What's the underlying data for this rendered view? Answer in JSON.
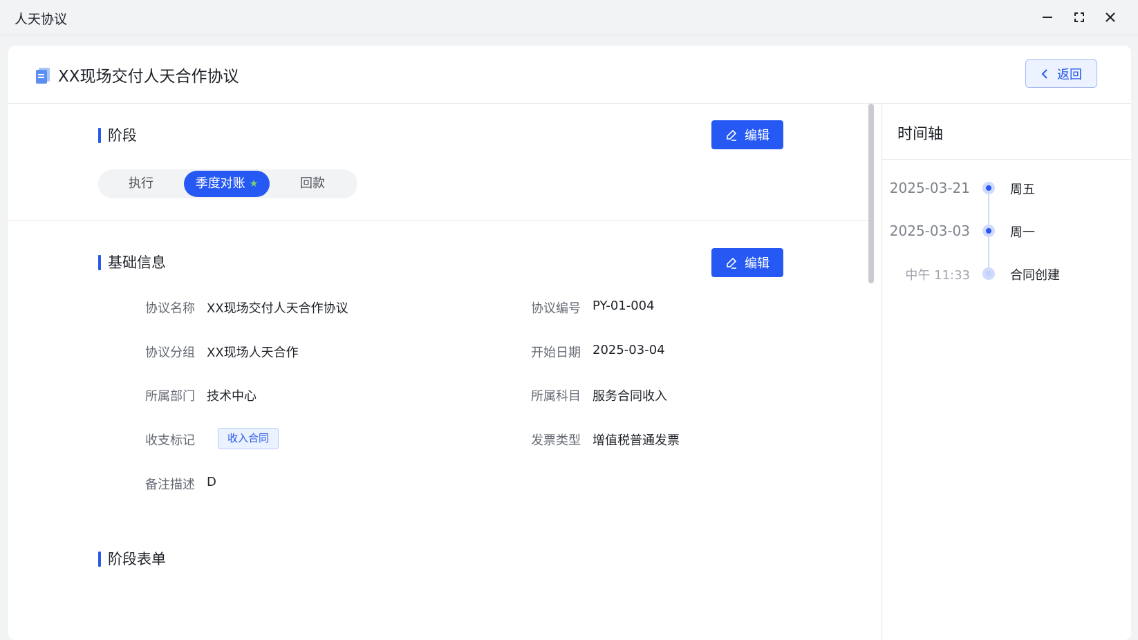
{
  "window": {
    "title": "人天协议"
  },
  "header": {
    "title": "XX现场交付人天合作协议",
    "back_label": "返回"
  },
  "stage_section": {
    "title": "阶段",
    "edit_label": "编辑",
    "stages": [
      {
        "label": "执行",
        "active": false
      },
      {
        "label": "季度对账",
        "active": true,
        "star": "★"
      },
      {
        "label": "回款",
        "active": false
      }
    ]
  },
  "basic_section": {
    "title": "基础信息",
    "edit_label": "编辑",
    "fields": {
      "name": {
        "label": "协议名称",
        "value": "XX现场交付人天合作协议"
      },
      "code": {
        "label": "协议编号",
        "value": "PY-01-004"
      },
      "group": {
        "label": "协议分组",
        "value": "XX现场人天合作"
      },
      "start_date": {
        "label": "开始日期",
        "value": "2025-03-04"
      },
      "department": {
        "label": "所属部门",
        "value": "技术中心"
      },
      "subject": {
        "label": "所属科目",
        "value": "服务合同收入"
      },
      "flag": {
        "label": "收支标记",
        "value": "收入合同"
      },
      "invoice": {
        "label": "发票类型",
        "value": "增值税普通发票"
      },
      "remark": {
        "label": "备注描述",
        "value": "D"
      }
    }
  },
  "form_section": {
    "title": "阶段表单"
  },
  "timeline": {
    "title": "时间轴",
    "entries": [
      {
        "date": "2025-03-21",
        "text": "周五"
      },
      {
        "date": "2025-03-03",
        "text": "周一"
      },
      {
        "date": "中午 11:33",
        "text": "合同创建"
      }
    ]
  },
  "colors": {
    "accent": "#2659f3",
    "tag_bg": "#eaf1ff",
    "star": "#7ed36b"
  },
  "icons": [
    "minimize-icon",
    "maximize-icon",
    "close-icon",
    "document-icon",
    "chevron-left-icon",
    "pencil-icon",
    "star-icon"
  ]
}
